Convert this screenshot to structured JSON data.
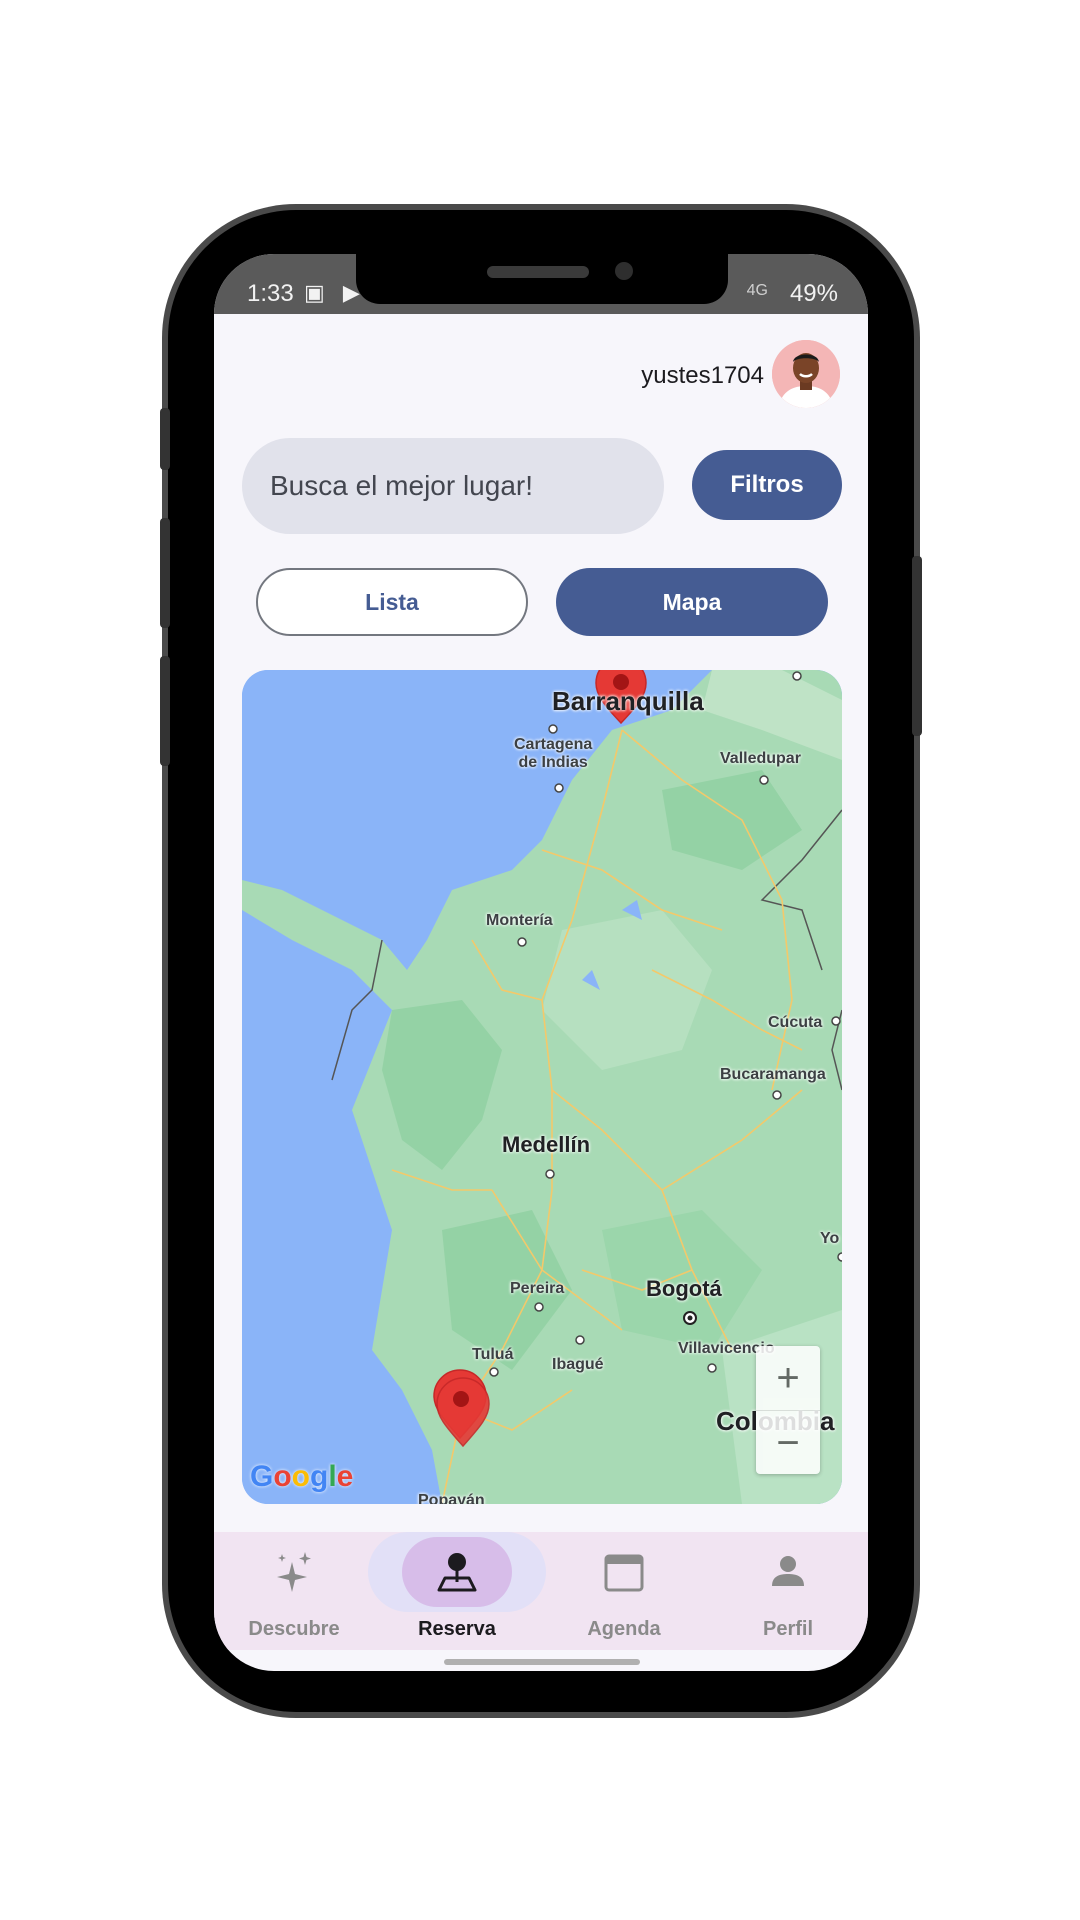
{
  "status_bar": {
    "time": "1:33",
    "notification_icons": "▣ ▶",
    "network": "4G",
    "battery": "49%"
  },
  "header": {
    "username": "yustes1704"
  },
  "search": {
    "placeholder": "Busca el mejor lugar!",
    "value": ""
  },
  "filters_button": {
    "label": "Filtros"
  },
  "view_toggle": {
    "options": [
      {
        "label": "Lista",
        "selected": false
      },
      {
        "label": "Mapa",
        "selected": true
      }
    ]
  },
  "map": {
    "provider": "Google",
    "labels": {
      "barranquilla": "Barranquilla",
      "cartagena": "Cartagena\nde Indias",
      "valledupar": "Valledupar",
      "monteria": "Montería",
      "cucuta": "Cúcuta",
      "bucaramanga": "Bucaramanga",
      "medellin": "Medellín",
      "yo": "Yo",
      "pereira": "Pereira",
      "bogota": "Bogotá",
      "tulua": "Tuluá",
      "ibague": "Ibagué",
      "villavicencio": "Villavicencio",
      "colombia": "Colombia",
      "popayan": "Popayán"
    },
    "zoom_in": "+",
    "zoom_out": "−",
    "markers": [
      "Barranquilla marker",
      "Cali marker"
    ]
  },
  "bottom_nav": {
    "items": [
      {
        "label": "Descubre",
        "icon": "sparkle-icon",
        "active": false
      },
      {
        "label": "Reserva",
        "icon": "pin-location-icon",
        "active": true
      },
      {
        "label": "Agenda",
        "icon": "calendar-icon",
        "active": false
      },
      {
        "label": "Perfil",
        "icon": "person-icon",
        "active": false
      }
    ]
  },
  "colors": {
    "primary": "#455c93",
    "map_water": "#8ab4f8",
    "map_land": "#a8dab5",
    "marker": "#e53935",
    "nav_bg": "#f1e4f2",
    "nav_active_pill": "#d7bde9"
  }
}
